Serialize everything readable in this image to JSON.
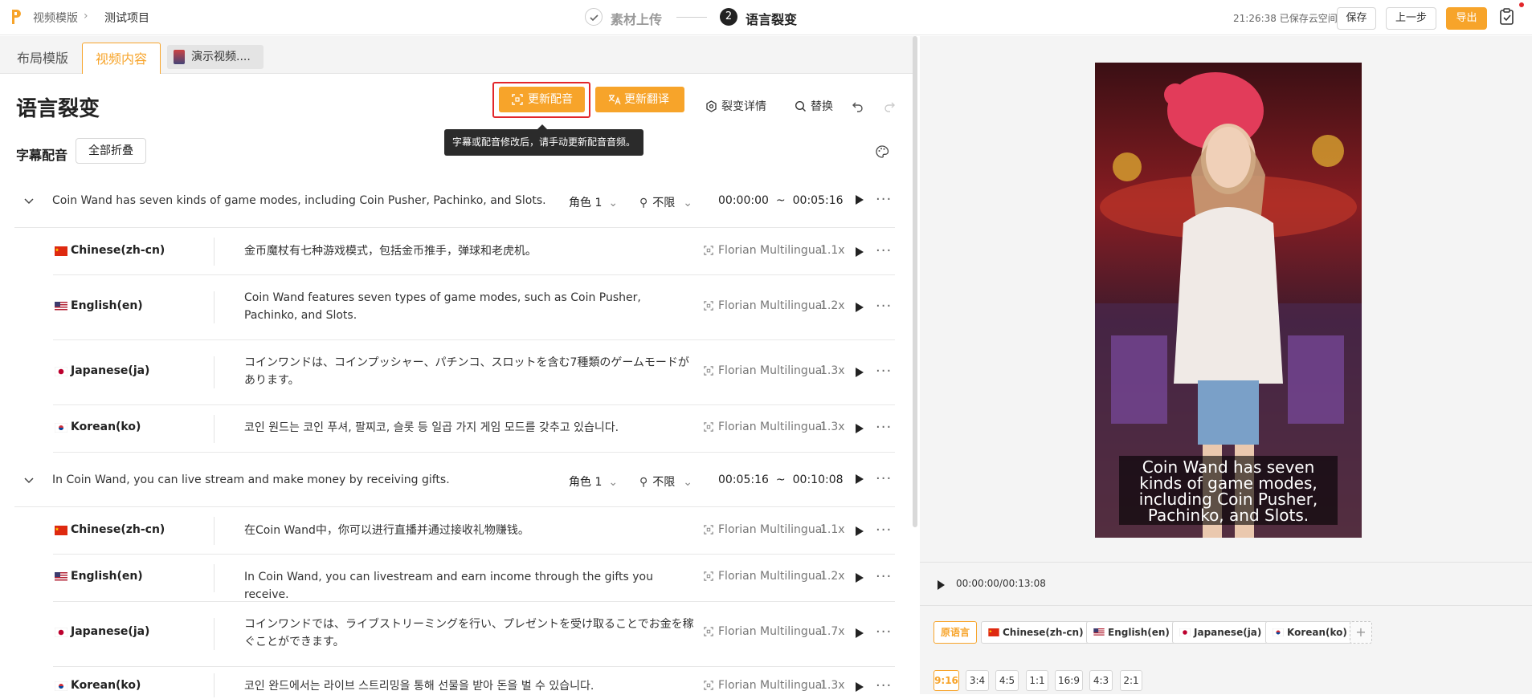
{
  "breadcrumb": {
    "template": "视频模版",
    "project": "测试项目"
  },
  "steps": [
    {
      "label": "素材上传"
    },
    {
      "num": "2",
      "label": "语言裂变"
    }
  ],
  "header": {
    "autosave": "21:26:38 已保存云空间",
    "save": "保存",
    "prev": "上一步",
    "export": "导出"
  },
  "tabs": [
    "布局模版",
    "视频内容",
    "演示视频...."
  ],
  "page_title": "语言裂变",
  "toolbar": {
    "update_dub": "更新配音",
    "update_translate": "更新翻译",
    "fission_detail": "裂变详情",
    "replace": "替换",
    "tooltip": "字幕或配音修改后，请手动更新配音音频。"
  },
  "subtitle_section": {
    "label": "字幕配音",
    "collapse_all": "全部折叠"
  },
  "groups": [
    {
      "text": "Coin Wand has seven kinds of game modes, including Coin Pusher, Pachinko, and Slots.",
      "role": "角色 1",
      "limit": "不限",
      "start": "00:00:00",
      "sep": "~",
      "end": "00:05:16",
      "translations": [
        {
          "lang": "Chinese(zh-cn)",
          "text": "金币魔杖有七种游戏模式，包括金币推手，弹球和老虎机。",
          "voice": "Florian Multilingual",
          "speed": "1.1x"
        },
        {
          "lang": "English(en)",
          "text": "Coin Wand features seven types of game modes, such as Coin Pusher, Pachinko, and Slots.",
          "voice": "Florian Multilingual",
          "speed": "1.2x"
        },
        {
          "lang": "Japanese(ja)",
          "text": "コインワンドは、コインプッシャー、パチンコ、スロットを含む7種類のゲームモードがあります。",
          "voice": "Florian Multilingual",
          "speed": "1.3x"
        },
        {
          "lang": "Korean(ko)",
          "text": "코인 원드는 코인 푸셔, 팔찌코, 슬롯 등 일곱 가지 게임 모드를 갖추고 있습니다.",
          "voice": "Florian Multilingual",
          "speed": "1.3x"
        }
      ]
    },
    {
      "text": "In Coin Wand, you can live stream and make money by receiving gifts.",
      "role": "角色 1",
      "limit": "不限",
      "start": "00:05:16",
      "sep": "~",
      "end": "00:10:08",
      "translations": [
        {
          "lang": "Chinese(zh-cn)",
          "text": "在Coin Wand中，你可以进行直播并通过接收礼物赚钱。",
          "voice": "Florian Multilingual",
          "speed": "1.1x"
        },
        {
          "lang": "English(en)",
          "text": "In Coin Wand, you can livestream and earn income through the gifts you receive.",
          "voice": "Florian Multilingual",
          "speed": "1.2x"
        },
        {
          "lang": "Japanese(ja)",
          "text": "コインワンドでは、ライブストリーミングを行い、プレゼントを受け取ることでお金を稼ぐことができます。",
          "voice": "Florian Multilingual",
          "speed": "1.7x"
        },
        {
          "lang": "Korean(ko)",
          "text": "코인 완드에서는 라이브 스트리밍을 통해 선물을 받아 돈을 벌 수 있습니다.",
          "voice": "Florian Multilingual",
          "speed": "1.3x"
        }
      ]
    }
  ],
  "preview": {
    "caption": "Coin Wand has seven kinds of game modes, including Coin Pusher, Pachinko, and Slots.",
    "time": "00:00:00/00:13:08",
    "languages": [
      "原语言",
      "Chinese(zh-cn)",
      "English(en)",
      "Japanese(ja)",
      "Korean(ko)"
    ],
    "ratios": [
      "9:16",
      "3:4",
      "4:5",
      "1:1",
      "16:9",
      "4:3",
      "2:1"
    ],
    "selected_ratio": "9:16"
  },
  "colors": {
    "accent": "#f7a42a",
    "highlight": "#e2262a"
  }
}
